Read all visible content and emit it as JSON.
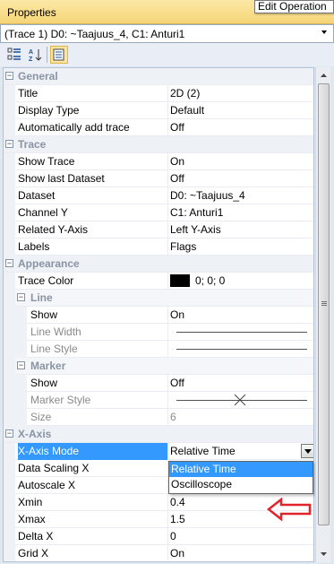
{
  "window": {
    "title": "Properties",
    "tooltip": "Edit Operation"
  },
  "selector": {
    "value": "(Trace 1) D0: ~Taajuus_4, C1: Anturi1"
  },
  "toolbar": {
    "buttons": [
      {
        "name": "categorized-view",
        "icon": "categorized-icon"
      },
      {
        "name": "alphabetical-view",
        "icon": "sort-az-icon"
      },
      {
        "name": "property-pages",
        "icon": "property-pages-icon",
        "active": true
      }
    ]
  },
  "categories": {
    "general": "General",
    "trace": "Trace",
    "appearance": "Appearance",
    "line": "Line",
    "marker": "Marker",
    "xaxis": "X-Axis"
  },
  "props": {
    "title": {
      "label": "Title",
      "value": "2D (2)"
    },
    "display_type": {
      "label": "Display Type",
      "value": "Default"
    },
    "auto_add": {
      "label": "Automatically add trace",
      "value": "Off"
    },
    "show_trace": {
      "label": "Show Trace",
      "value": "On"
    },
    "show_last": {
      "label": "Show last Dataset",
      "value": "Off"
    },
    "dataset": {
      "label": "Dataset",
      "value": "D0: ~Taajuus_4"
    },
    "channel_y": {
      "label": "Channel Y",
      "value": "C1: Anturi1"
    },
    "related_y": {
      "label": "Related Y-Axis",
      "value": "Left Y-Axis"
    },
    "labels": {
      "label": "Labels",
      "value": "Flags"
    },
    "trace_color": {
      "label": "Trace Color",
      "value": "0; 0; 0",
      "color": "#000000"
    },
    "line_show": {
      "label": "Show",
      "value": "On"
    },
    "line_width": {
      "label": "Line Width"
    },
    "line_style": {
      "label": "Line Style"
    },
    "marker_show": {
      "label": "Show",
      "value": "Off"
    },
    "marker_style": {
      "label": "Marker Style"
    },
    "size": {
      "label": "Size",
      "value": "6"
    },
    "x_axis_mode": {
      "label": "X-Axis Mode",
      "value": "Relative Time"
    },
    "data_scaling_x": {
      "label": "Data Scaling X"
    },
    "autoscale_x": {
      "label": "Autoscale X"
    },
    "xmin": {
      "label": "Xmin",
      "value": "0.4"
    },
    "xmax": {
      "label": "Xmax",
      "value": "1.5"
    },
    "delta_x": {
      "label": "Delta X",
      "value": "0"
    },
    "grid_x": {
      "label": "Grid X",
      "value": "On"
    }
  },
  "dropdown": {
    "options": [
      "Relative Time",
      "Oscilloscope"
    ],
    "highlighted_option": "Relative Time"
  },
  "colors": {
    "selection": "#3399ff",
    "annotation_arrow": "#e0242a",
    "titlebar": "#f6d577"
  }
}
